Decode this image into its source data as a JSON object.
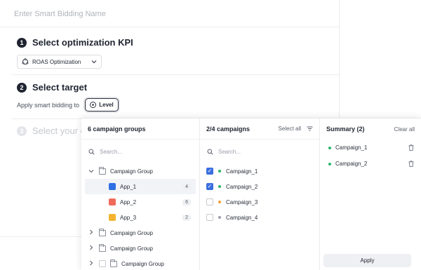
{
  "form": {
    "name_placeholder": "Enter Smart Bidding Name",
    "step1": {
      "num": "1",
      "title": "Select optimization KPI"
    },
    "kpi_value": "ROAS Optimization",
    "step2": {
      "num": "2",
      "title": "Select target"
    },
    "apply_to_label": "Apply smart bidding to",
    "level_button": "Level",
    "step3": {
      "num": "3",
      "title": "Select your op"
    }
  },
  "groups_panel": {
    "header": "6 campaign groups",
    "search_placeholder": "Search...",
    "items": [
      {
        "type": "group",
        "label": "Campaign Group",
        "expanded": true
      },
      {
        "type": "app",
        "label": "App_1",
        "count": "4",
        "color": "#2f6fe4",
        "active": true
      },
      {
        "type": "app",
        "label": "App_2",
        "count": "6",
        "color": "#f06a5a"
      },
      {
        "type": "app",
        "label": "App_3",
        "count": "2",
        "color": "#f4b32f"
      },
      {
        "type": "group",
        "label": "Campaign Group",
        "expanded": false
      },
      {
        "type": "group",
        "label": "Campaign Group",
        "expanded": false
      },
      {
        "type": "group-checkbox",
        "label": "Campaign Group",
        "expanded": false
      }
    ]
  },
  "campaigns_panel": {
    "header": "2/4 campaigns",
    "select_all": "Select all",
    "search_placeholder": "Search...",
    "items": [
      {
        "label": "Campaign_1",
        "checked": true,
        "dot": "#2cb36b"
      },
      {
        "label": "Campaign_2",
        "checked": true,
        "dot": "#2cb36b"
      },
      {
        "label": "Campaign_3",
        "checked": false,
        "dot": "#f2a23a"
      },
      {
        "label": "Campaign_4",
        "checked": false,
        "dot": "#9a9daa"
      }
    ]
  },
  "summary_panel": {
    "header": "Summary (2)",
    "clear_all": "Clear all",
    "items": [
      {
        "label": "Campaign_1",
        "dot": "#2cb36b"
      },
      {
        "label": "Campaign_2",
        "dot": "#2cb36b"
      }
    ],
    "apply": "Apply"
  }
}
